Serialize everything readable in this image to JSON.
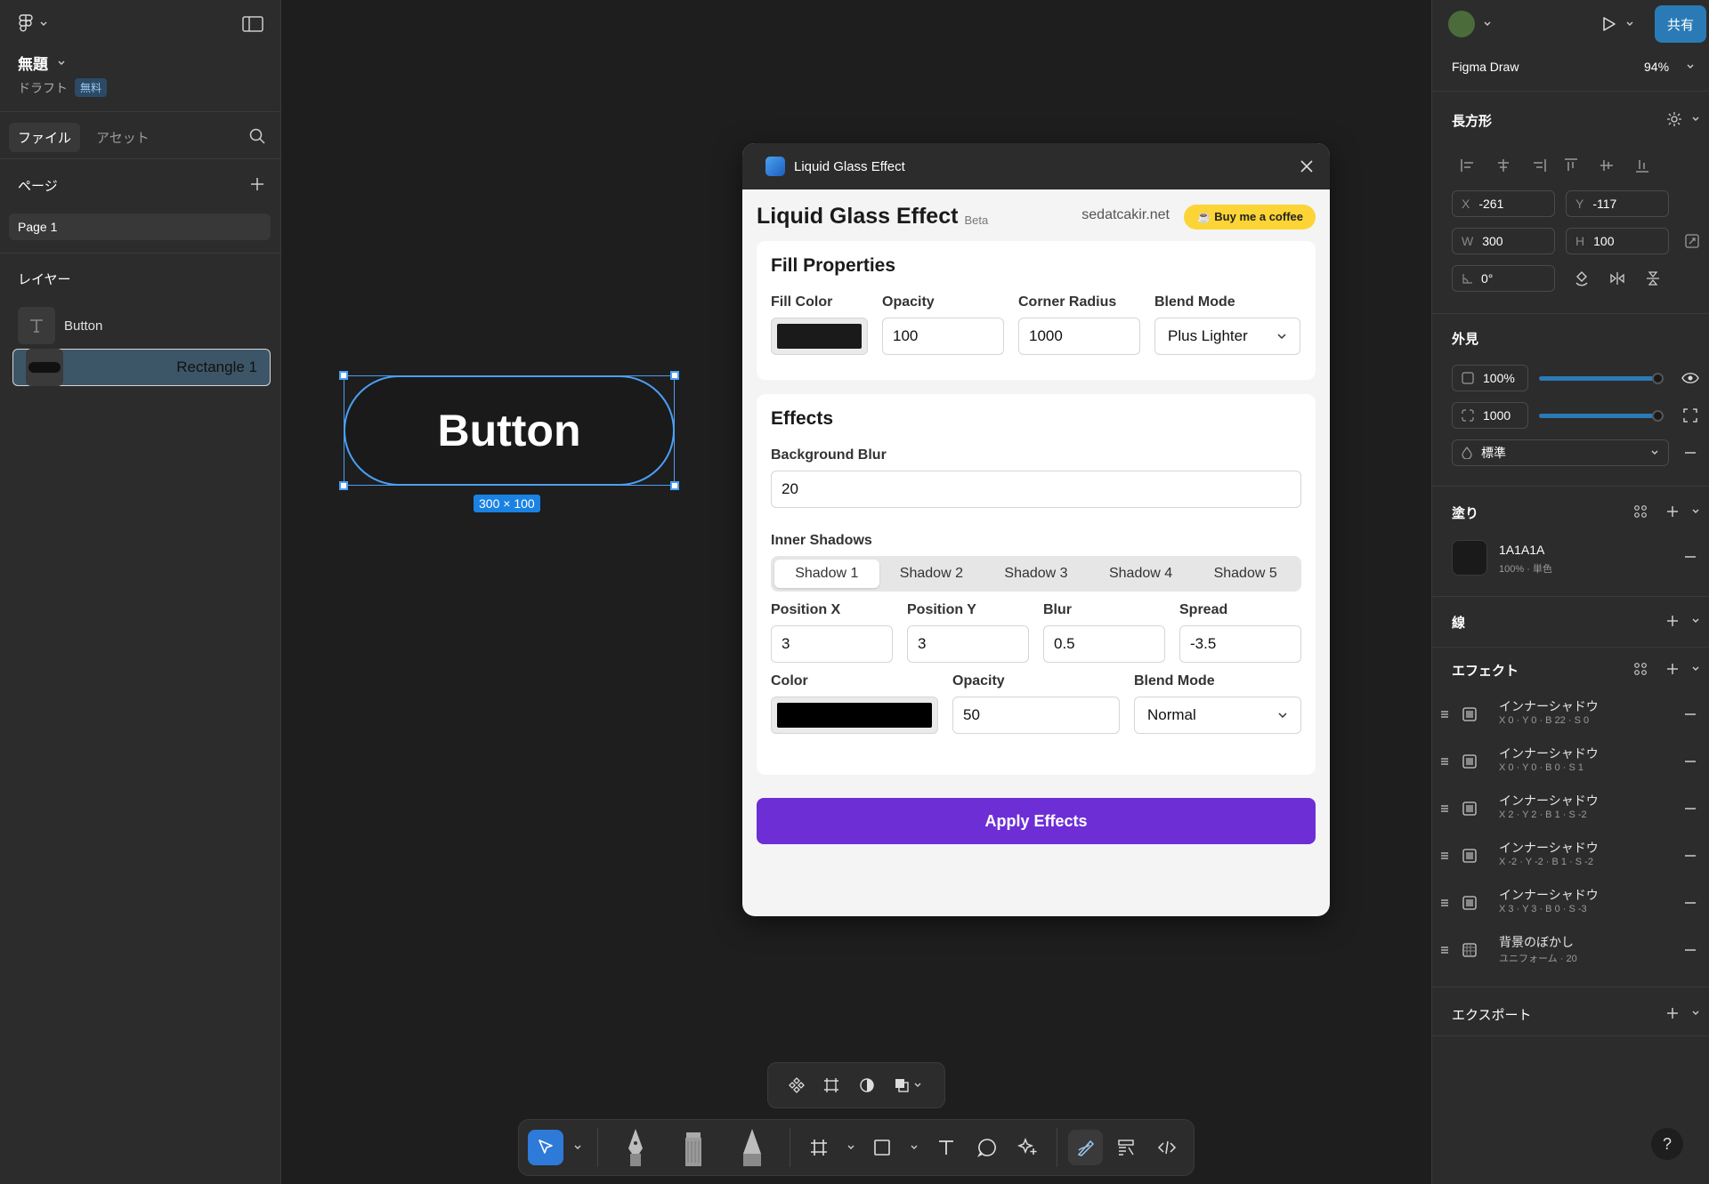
{
  "left": {
    "file_title": "無題",
    "draft_label": "ドラフト",
    "free_badge": "無料",
    "tabs": [
      "ファイル",
      "アセット"
    ],
    "pages_heading": "ページ",
    "page_item": "Page 1",
    "layers_heading": "レイヤー",
    "layers": [
      "Button",
      "Rectangle 1"
    ]
  },
  "canvas": {
    "button_text": "Button",
    "size_label": "300 × 100"
  },
  "plugin": {
    "window_title": "Liquid Glass Effect",
    "title": "Liquid Glass Effect",
    "beta": "Beta",
    "site": "sedatcakir.net",
    "coffee": "☕ Buy me a coffee",
    "fill": {
      "heading": "Fill Properties",
      "fill_color_label": "Fill Color",
      "fill_color": "#1a1a1a",
      "opacity_label": "Opacity",
      "opacity": "100",
      "radius_label": "Corner Radius",
      "radius": "1000",
      "blend_label": "Blend Mode",
      "blend": "Plus Lighter"
    },
    "effects": {
      "heading": "Effects",
      "bg_blur_label": "Background Blur",
      "bg_blur": "20",
      "inner_shadows_label": "Inner Shadows",
      "shadow_tabs": [
        "Shadow 1",
        "Shadow 2",
        "Shadow 3",
        "Shadow 4",
        "Shadow 5"
      ],
      "pos_x_label": "Position X",
      "pos_x": "3",
      "pos_y_label": "Position Y",
      "pos_y": "3",
      "blur_label": "Blur",
      "blur": "0.5",
      "spread_label": "Spread",
      "spread": "-3.5",
      "color_label": "Color",
      "color": "#000000",
      "s_opacity_label": "Opacity",
      "s_opacity": "50",
      "s_blend_label": "Blend Mode",
      "s_blend": "Normal"
    },
    "apply": "Apply Effects"
  },
  "right": {
    "share": "共有",
    "mode": "Figma Draw",
    "zoom": "94%",
    "shape_heading": "長方形",
    "x_k": "X",
    "x": "-261",
    "y_k": "Y",
    "y": "-117",
    "w_k": "W",
    "w": "300",
    "h_k": "H",
    "h": "100",
    "rotation": "0°",
    "appearance_heading": "外見",
    "opacity": "100%",
    "opacity_level": 0.95,
    "radius": "1000",
    "radius_level": 0.95,
    "blend": "標準",
    "fill_heading": "塗り",
    "fill_hex": "1A1A1A",
    "fill_sub": "100% · 単色",
    "stroke_heading": "線",
    "effects_heading": "エフェクト",
    "effects": [
      {
        "title": "インナーシャドウ",
        "sub": "X 0 · Y 0 · B 22 · S 0"
      },
      {
        "title": "インナーシャドウ",
        "sub": "X 0 · Y 0 · B 0 · S 1"
      },
      {
        "title": "インナーシャドウ",
        "sub": "X 2 · Y 2 · B 1 · S -2"
      },
      {
        "title": "インナーシャドウ",
        "sub": "X -2 · Y -2 · B 1 · S -2"
      },
      {
        "title": "インナーシャドウ",
        "sub": "X 3 · Y 3 · B 0 · S -3"
      },
      {
        "title": "背景のぼかし",
        "sub": "ユニフォーム · 20"
      }
    ],
    "export_heading": "エクスポート",
    "help": "?"
  }
}
